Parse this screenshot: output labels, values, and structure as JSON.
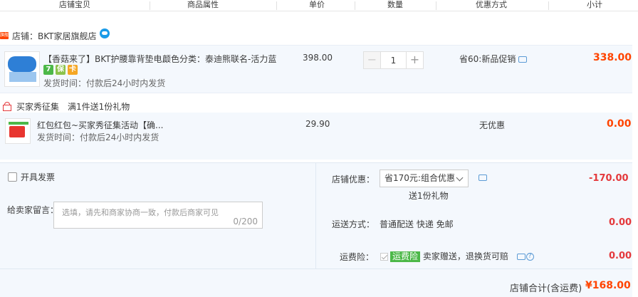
{
  "header": {
    "cols": [
      "店铺宝贝",
      "商品属性",
      "单价",
      "数量",
      "优惠方式",
      "小计"
    ]
  },
  "shop": {
    "icon_text": "旗舰",
    "label": "店铺：",
    "name": "BKT家居旗舰店"
  },
  "items": [
    {
      "title": "【香菇来了】BKT护腰靠背垫电...",
      "property": "颜色分类：泰迪熊联名-活力蓝",
      "badges": [
        {
          "text": "7",
          "color": "#4cb848"
        },
        {
          "text": "保",
          "color": "#8cc34b"
        },
        {
          "text": "卡",
          "color": "#f5a623"
        }
      ],
      "ship_time": "发货时间：付款后24小时内发货",
      "price": "398.00",
      "quantity": "1",
      "qty_minus": "−",
      "qty_plus": "+",
      "promo": "省60:新品促销",
      "subtotal": "338.00"
    },
    {
      "title": "红包红包~买家秀征集活动【确...",
      "ship_time": "发货时间：付款后24小时内发货",
      "price": "29.90",
      "promo": "无优惠",
      "subtotal": "0.00"
    }
  ],
  "gift_group": {
    "name": "买家秀征集",
    "rule": "满1件送1份礼物"
  },
  "order": {
    "invoice_label": "开具发票",
    "message_label": "给卖家留言：",
    "message_placeholder": "选填，请先和商家协商一致，付款后商家可见",
    "message_count": "0/200",
    "shop_discount_label": "店铺优惠：",
    "shop_discount_value": "省170元:组合优惠",
    "shop_discount_gift": "送1份礼物",
    "shop_discount_amount": "-170.00",
    "delivery_label": "运送方式：",
    "delivery_value": "普通配送 快递 免邮",
    "delivery_amount": "0.00",
    "insurance_label": "运费险：",
    "insurance_tag": "运费险",
    "insurance_text": "卖家赠送，退换货可赔",
    "insurance_amount": "0.00",
    "total_label": "店铺合计(含运费)",
    "total_value": "¥168.00"
  },
  "colors": {
    "accent": "#ff4400",
    "discount": "#e4393c",
    "panel_bg": "#f4f8fd",
    "link": "#5b9bd5"
  }
}
